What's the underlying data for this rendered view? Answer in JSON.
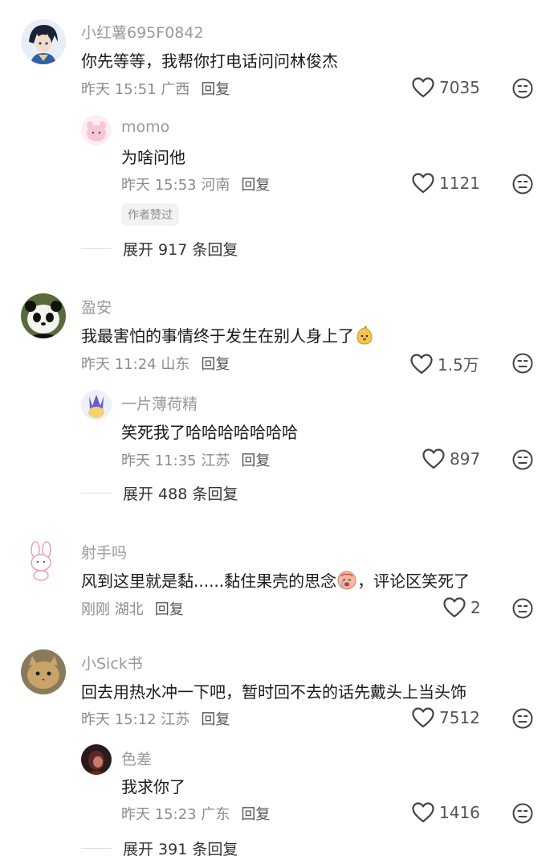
{
  "comments": [
    {
      "user": "小红薯695F0842",
      "text": "你先等等，我帮你打电话问问林俊杰",
      "time": "昨天 15:51 广西",
      "reply_label": "回复",
      "likes": "7035",
      "replies": [
        {
          "user": "momo",
          "text": "为啥问他",
          "time": "昨天 15:53 河南",
          "reply_label": "回复",
          "likes": "1121",
          "badge": "作者赞过"
        }
      ],
      "expand": "展开 917 条回复"
    },
    {
      "user": "盈安",
      "text": "我最害怕的事情终于发生在别人身上了",
      "time": "昨天 11:24 山东",
      "reply_label": "回复",
      "likes": "1.5万",
      "replies": [
        {
          "user": "一片薄荷精",
          "text": "笑死我了哈哈哈哈哈哈哈",
          "time": "昨天 11:35 江苏",
          "reply_label": "回复",
          "likes": "897"
        }
      ],
      "expand": "展开 488 条回复"
    },
    {
      "user": "射手吗",
      "text_a": "风到这里就是黏......黏住果壳的思念",
      "text_b": "，评论区笑死了",
      "time": "刚刚 湖北",
      "reply_label": "回复",
      "likes": "2"
    },
    {
      "user": "小Sick书",
      "text": "回去用热水冲一下吧，暂时回不去的话先戴头上当头饰",
      "time": "昨天 15:12 江苏",
      "reply_label": "回复",
      "likes": "7512",
      "replies": [
        {
          "user": "色差",
          "text": "我求你了",
          "time": "昨天 15:23 广东",
          "reply_label": "回复",
          "likes": "1416"
        }
      ],
      "expand": "展开 391 条回复"
    }
  ],
  "icons": {
    "like": "heart-outline-icon",
    "dislike": "neutral-face-icon",
    "emoji_1": "pear-face-emoji",
    "emoji_2": "crying-face-emoji"
  },
  "colors": {
    "username": "#9a9a9a",
    "text": "#1a1a1a",
    "meta": "#8c8c8c"
  }
}
